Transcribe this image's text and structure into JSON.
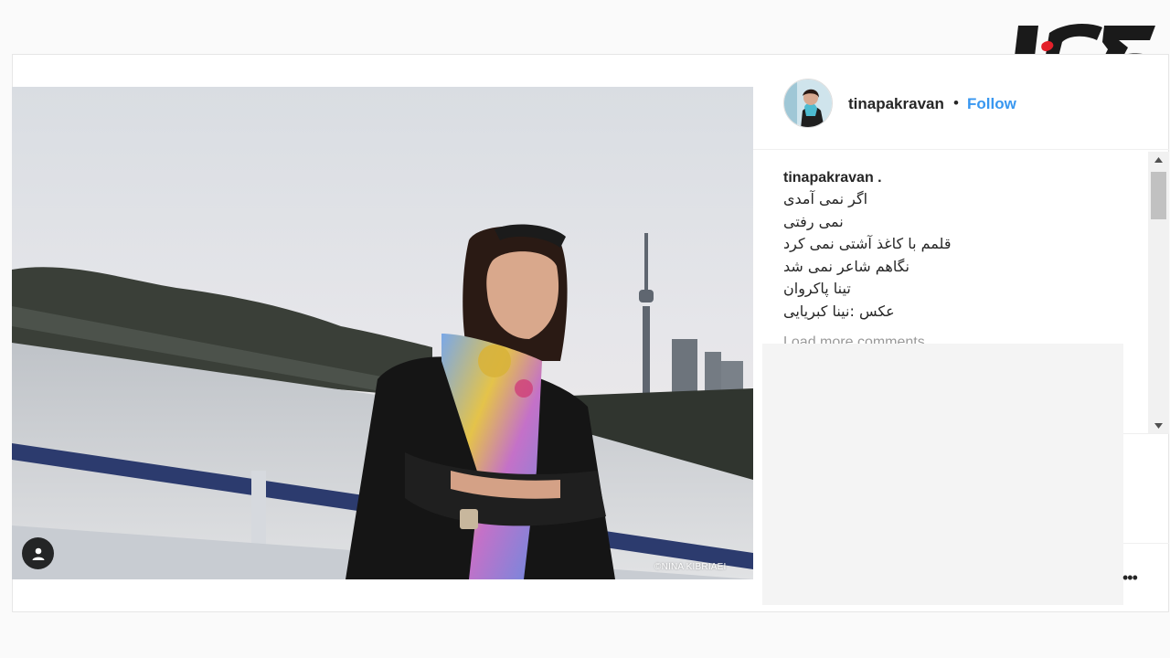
{
  "header": {
    "username": "tinapakravan",
    "separator": "•",
    "follow_label": "Follow"
  },
  "caption": {
    "username": "tinapakravan .",
    "lines": [
      "اگر نمی آمدی",
      "نمی رفتی",
      "قلمم با کاغذ آشتی نمی کرد",
      "نگاهم شاعر نمی شد",
      "تینا پاکروان",
      "عکس :نینا کبریایی"
    ]
  },
  "load_more_label": "Load more comments",
  "photo": {
    "credit": "©NINA KIBRIAEI"
  },
  "more_label": "•••",
  "colors": {
    "follow": "#3897f0",
    "logo_red": "#e3202a",
    "logo_dark": "#1a1a1a"
  }
}
